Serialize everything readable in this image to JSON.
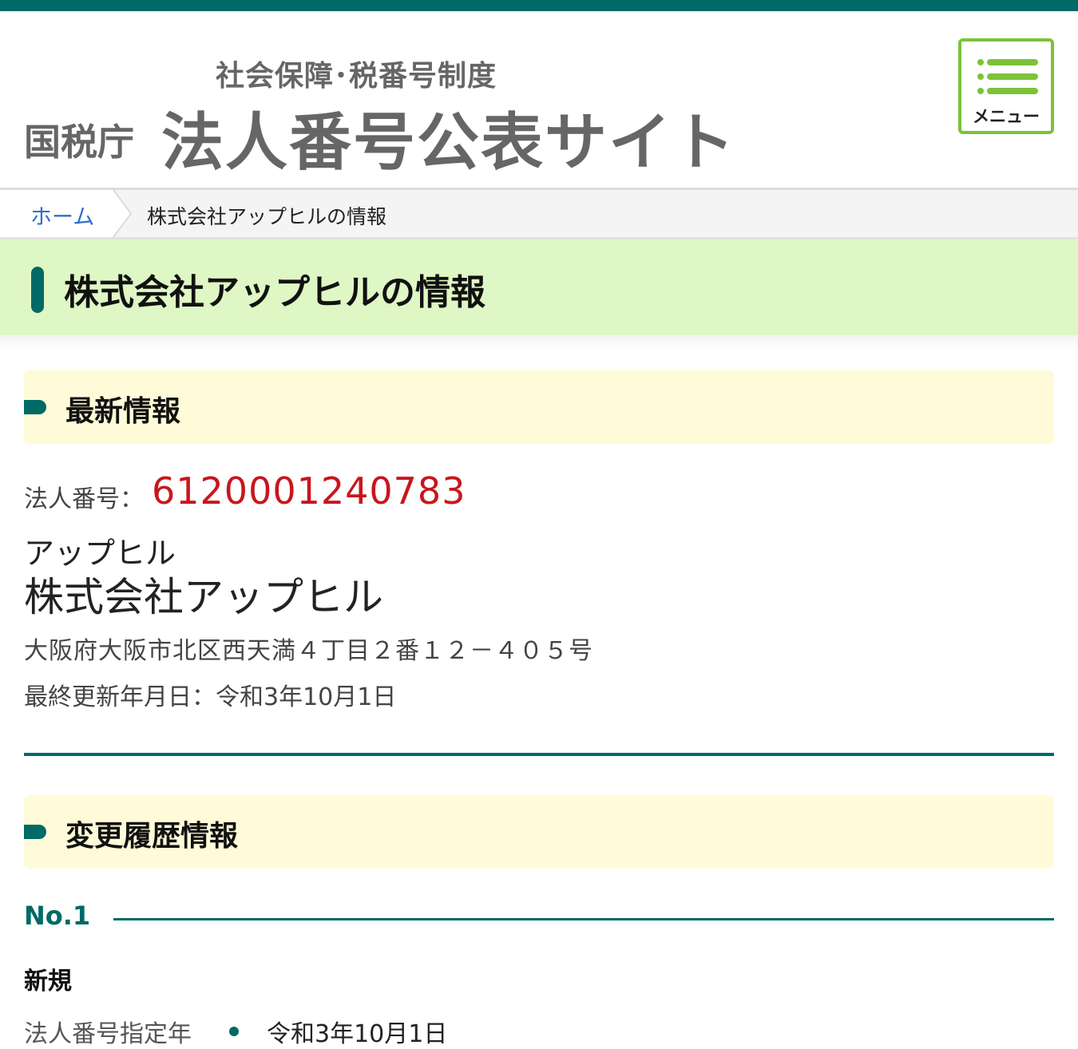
{
  "header": {
    "subtitle": "社会保障･税番号制度",
    "agency": "国税庁",
    "site_name": "法人番号公表サイト",
    "menu_label": "メニュー"
  },
  "breadcrumb": {
    "home": "ホーム",
    "current": "株式会社アップヒルの情報"
  },
  "page": {
    "title": "株式会社アップヒルの情報"
  },
  "latest": {
    "heading": "最新情報",
    "number_label": "法人番号：",
    "number_value": "6120001240783",
    "kana": "アップヒル",
    "name": "株式会社アップヒル",
    "address": "大阪府大阪市北区西天満４丁目２番１２－４０５号",
    "updated": "最終更新年月日：令和3年10月1日"
  },
  "history": {
    "heading": "変更履歴情報",
    "entries": [
      {
        "no": "No.1",
        "type": "新規",
        "field_label": "法人番号指定年",
        "field_value": "令和3年10月1日"
      }
    ]
  },
  "colors": {
    "brand": "#006a66",
    "accent_green": "#7cc338",
    "number_red": "#c8161d",
    "page_head_bg": "#dff7c4",
    "section_head_bg": "#fffbd8"
  },
  "icons": {
    "menu": "hamburger-menu-icon",
    "breadcrumb_separator": "chevron-right-icon"
  }
}
